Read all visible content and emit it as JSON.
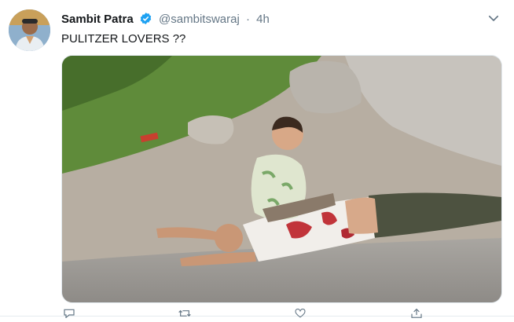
{
  "tweet": {
    "author_name": "Sambit Patra",
    "handle": "@sambitswaraj",
    "separator": "·",
    "time": "4h",
    "text": "PULITZER LOVERS ??"
  },
  "icons": {
    "avatar": "profile-photo",
    "verified": "verified-badge-icon",
    "menu": "chevron-down-icon",
    "media": "photo-child-sitting-on-man-lying-on-road",
    "actions": [
      "reply-icon",
      "retweet-icon",
      "like-icon",
      "share-icon"
    ]
  },
  "colors": {
    "accent": "#1da1f2",
    "text": "#14171a",
    "muted": "#657786"
  }
}
